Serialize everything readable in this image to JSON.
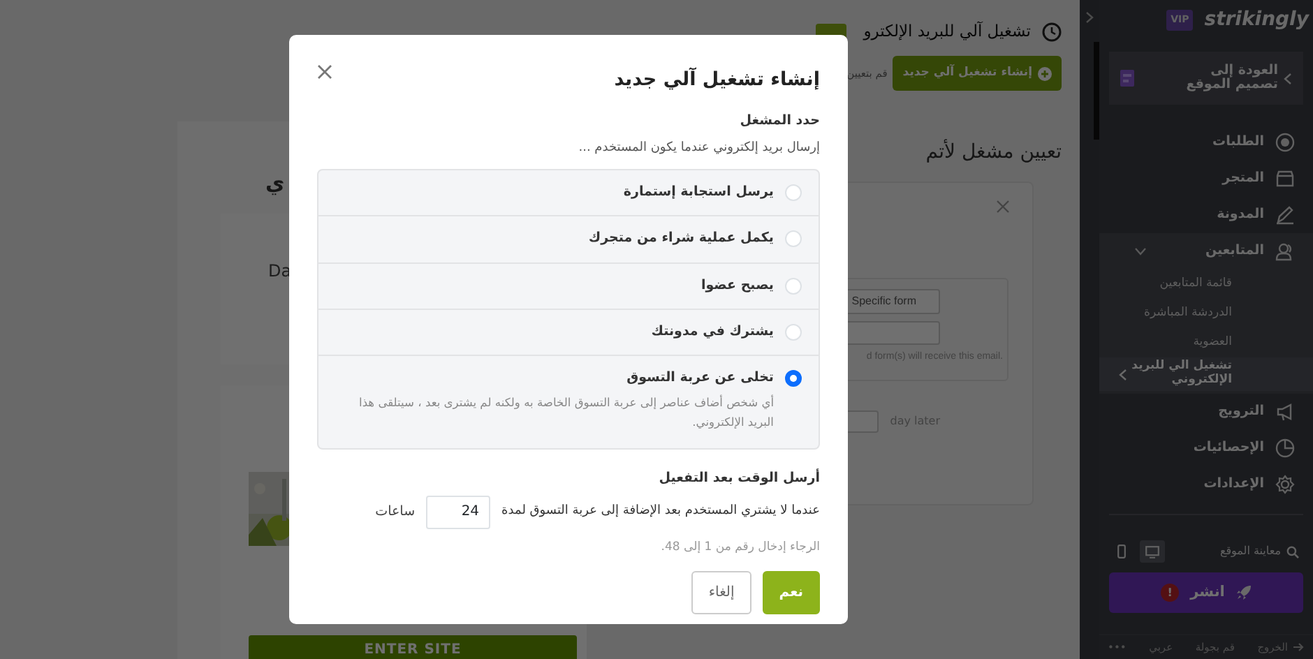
{
  "page": {
    "title": "تشغيل آلي للبريد الإلكترو",
    "new_button": "إنشاء تشغيل آلي جديد",
    "hint": "قم بتعيين",
    "section_title": "تعيين مشغل لأتم",
    "trigger_card": {
      "select": "Specific form",
      "note": "d form(s) will receive this email.",
      "delay_unit": "day later"
    }
  },
  "site_preview": {
    "heading": "ي",
    "text": "Da",
    "button": "ENTER SITE"
  },
  "sidebar": {
    "logo": "strikingly",
    "plan": "VIP",
    "back_link": "العودة إلى تصميم الموقع",
    "nav": [
      {
        "label": "الطلبات"
      },
      {
        "label": "المتجر"
      },
      {
        "label": "المدونة"
      },
      {
        "label": "المتابعين",
        "expanded": true,
        "children": [
          {
            "label": "قائمة المتابعين",
            "selected": false
          },
          {
            "label": "الدردشة المباشرة",
            "selected": false
          },
          {
            "label": "العضوية",
            "selected": false
          },
          {
            "label": "تشغيل الي للبريد الإلكتروني",
            "selected": true
          }
        ]
      },
      {
        "label": "الترويج"
      },
      {
        "label": "الإحصائيات"
      },
      {
        "label": "الإعدادات"
      }
    ],
    "preview": {
      "label": "معاينة الموقع",
      "devices": [
        {
          "selected": true
        },
        {
          "selected": false
        }
      ]
    },
    "publish": {
      "label": "انشر",
      "alert": "!"
    },
    "footer": [
      "الخروج",
      "قم بجولة",
      "عربي",
      "•••"
    ]
  },
  "modal": {
    "title": "إنشاء تشغيل آلي جديد",
    "trigger_label": "حدد المشغل",
    "trigger_hint": "إرسال بريد إلكتروني عندما يكون المستخدم ...",
    "options": [
      {
        "label": "يرسل استجابة إستمارة",
        "selected": false
      },
      {
        "label": "يكمل عملية شراء من متجرك",
        "selected": false
      },
      {
        "label": "يصبح عضوا",
        "selected": false
      },
      {
        "label": "يشترك في مدونتك",
        "selected": false
      },
      {
        "label": "تخلى عن عربة التسوق",
        "selected": true,
        "description": "أي شخص أضاف عناصر إلى عربة التسوق الخاصة به ولكنه لم يشترى بعد ، سيتلقى هذا البريد الإلكتروني."
      }
    ],
    "delay_label": "أرسل الوقت بعد التفعيل",
    "delay_sentence": "عندما لا يشتري المستخدم بعد الإضافة إلى عربة التسوق لمدة",
    "delay_value": "24",
    "delay_unit": "ساعات",
    "delay_hint": "الرجاء إدخال رقم من 1 إلى 48.",
    "buttons": [
      {
        "label": "نعم",
        "kind": "primary"
      },
      {
        "label": "إلغاء",
        "kind": "secondary"
      }
    ]
  }
}
